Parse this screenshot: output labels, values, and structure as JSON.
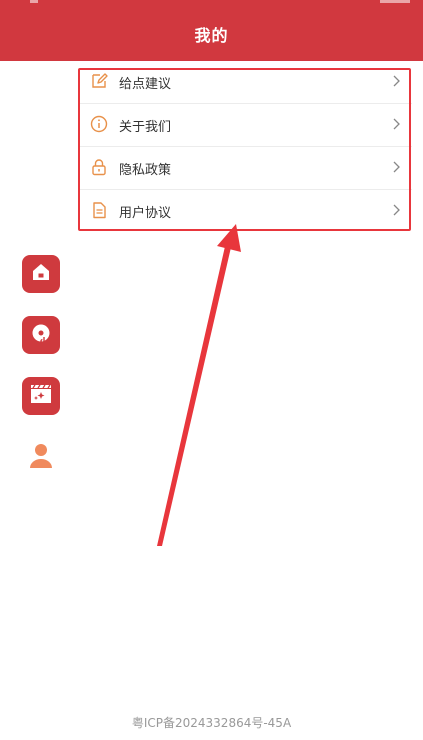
{
  "header": {
    "title": "我的"
  },
  "menu": {
    "items": [
      {
        "label": "给点建议",
        "icon": "edit-icon"
      },
      {
        "label": "关于我们",
        "icon": "info-icon"
      },
      {
        "label": "隐私政策",
        "icon": "lock-icon"
      },
      {
        "label": "用户协议",
        "icon": "document-icon"
      }
    ]
  },
  "sidebar": {
    "items": [
      {
        "icon": "home-icon"
      },
      {
        "icon": "music-disc-icon"
      },
      {
        "icon": "video-clapper-icon"
      },
      {
        "icon": "user-icon"
      }
    ]
  },
  "footer": {
    "icp": "粤ICP备2024332864号-45A"
  },
  "colors": {
    "brand_red": "#d1383f",
    "icon_orange": "#e8914a",
    "annotation_red": "#e8363c"
  }
}
